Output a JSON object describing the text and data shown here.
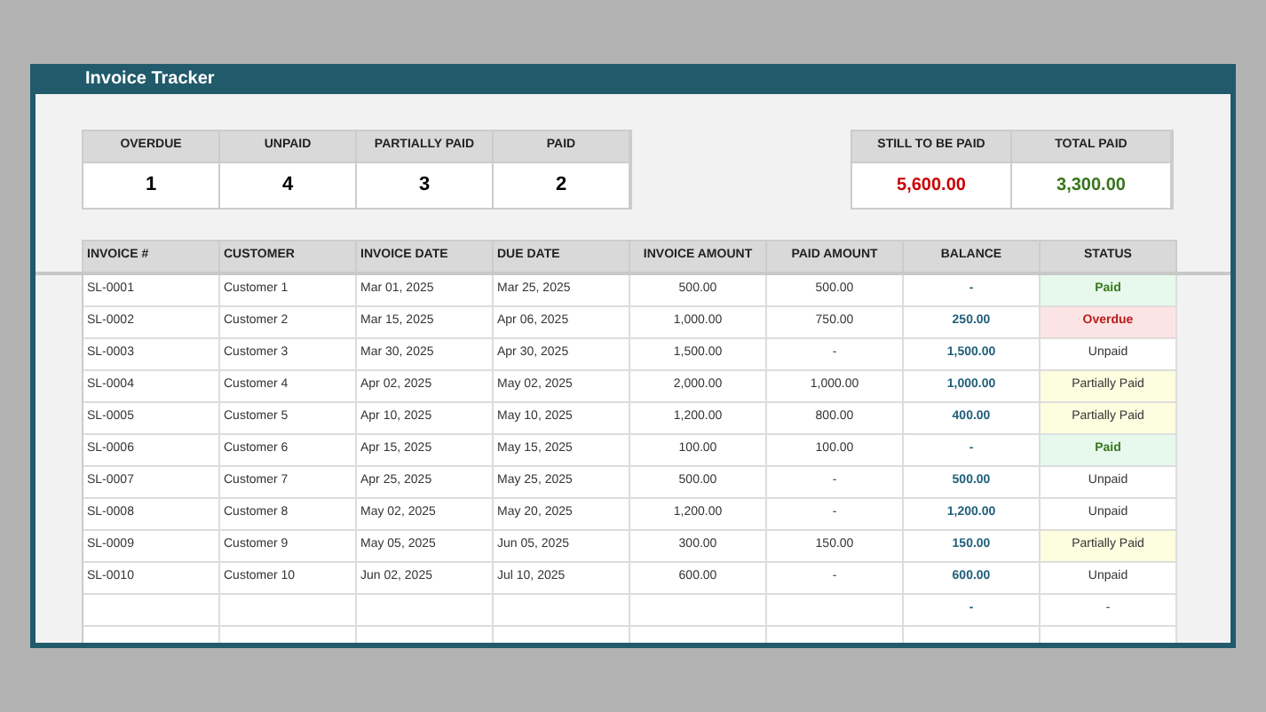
{
  "window": {
    "title": "Invoice Tracker"
  },
  "summary_counts": [
    {
      "label": "OVERDUE",
      "value": "1"
    },
    {
      "label": "UNPAID",
      "value": "4"
    },
    {
      "label": "PARTIALLY PAID",
      "value": "3"
    },
    {
      "label": "PAID",
      "value": "2"
    }
  ],
  "summary_totals": [
    {
      "label": "STILL TO BE PAID",
      "value": "5,600.00",
      "color": "#cc0000"
    },
    {
      "label": "TOTAL PAID",
      "value": "3,300.00",
      "color": "#38761d"
    }
  ],
  "table": {
    "columns": [
      "INVOICE #",
      "CUSTOMER",
      "INVOICE DATE",
      "DUE DATE",
      "INVOICE AMOUNT",
      "PAID AMOUNT",
      "BALANCE",
      "STATUS"
    ],
    "rows": [
      {
        "invoice": "SL-0001",
        "customer": "Customer 1",
        "invoice_date": "Mar 01, 2025",
        "due_date": "Mar 25, 2025",
        "amount": "500.00",
        "paid": "500.00",
        "balance": "-",
        "status": "Paid",
        "kind": "paid"
      },
      {
        "invoice": "SL-0002",
        "customer": "Customer 2",
        "invoice_date": "Mar 15, 2025",
        "due_date": "Apr 06, 2025",
        "amount": "1,000.00",
        "paid": "750.00",
        "balance": "250.00",
        "status": "Overdue",
        "kind": "overdue"
      },
      {
        "invoice": "SL-0003",
        "customer": "Customer 3",
        "invoice_date": "Mar 30, 2025",
        "due_date": "Apr 30, 2025",
        "amount": "1,500.00",
        "paid": "-",
        "balance": "1,500.00",
        "status": "Unpaid",
        "kind": "unpaid"
      },
      {
        "invoice": "SL-0004",
        "customer": "Customer 4",
        "invoice_date": "Apr 02, 2025",
        "due_date": "May 02, 2025",
        "amount": "2,000.00",
        "paid": "1,000.00",
        "balance": "1,000.00",
        "status": "Partially Paid",
        "kind": "partial"
      },
      {
        "invoice": "SL-0005",
        "customer": "Customer 5",
        "invoice_date": "Apr 10, 2025",
        "due_date": "May 10, 2025",
        "amount": "1,200.00",
        "paid": "800.00",
        "balance": "400.00",
        "status": "Partially Paid",
        "kind": "partial"
      },
      {
        "invoice": "SL-0006",
        "customer": "Customer 6",
        "invoice_date": "Apr 15, 2025",
        "due_date": "May 15, 2025",
        "amount": "100.00",
        "paid": "100.00",
        "balance": "-",
        "status": "Paid",
        "kind": "paid"
      },
      {
        "invoice": "SL-0007",
        "customer": "Customer 7",
        "invoice_date": "Apr 25, 2025",
        "due_date": "May 25, 2025",
        "amount": "500.00",
        "paid": "-",
        "balance": "500.00",
        "status": "Unpaid",
        "kind": "unpaid"
      },
      {
        "invoice": "SL-0008",
        "customer": "Customer 8",
        "invoice_date": "May 02, 2025",
        "due_date": "May 20, 2025",
        "amount": "1,200.00",
        "paid": "-",
        "balance": "1,200.00",
        "status": "Unpaid",
        "kind": "unpaid"
      },
      {
        "invoice": "SL-0009",
        "customer": "Customer 9",
        "invoice_date": "May 05, 2025",
        "due_date": "Jun 05, 2025",
        "amount": "300.00",
        "paid": "150.00",
        "balance": "150.00",
        "status": "Partially Paid",
        "kind": "partial"
      },
      {
        "invoice": "SL-0010",
        "customer": "Customer 10",
        "invoice_date": "Jun 02, 2025",
        "due_date": "Jul 10, 2025",
        "amount": "600.00",
        "paid": "-",
        "balance": "600.00",
        "status": "Unpaid",
        "kind": "unpaid"
      },
      {
        "invoice": "",
        "customer": "",
        "invoice_date": "",
        "due_date": "",
        "amount": "",
        "paid": "",
        "balance": "-",
        "status": "-",
        "kind": "unpaid"
      }
    ]
  }
}
